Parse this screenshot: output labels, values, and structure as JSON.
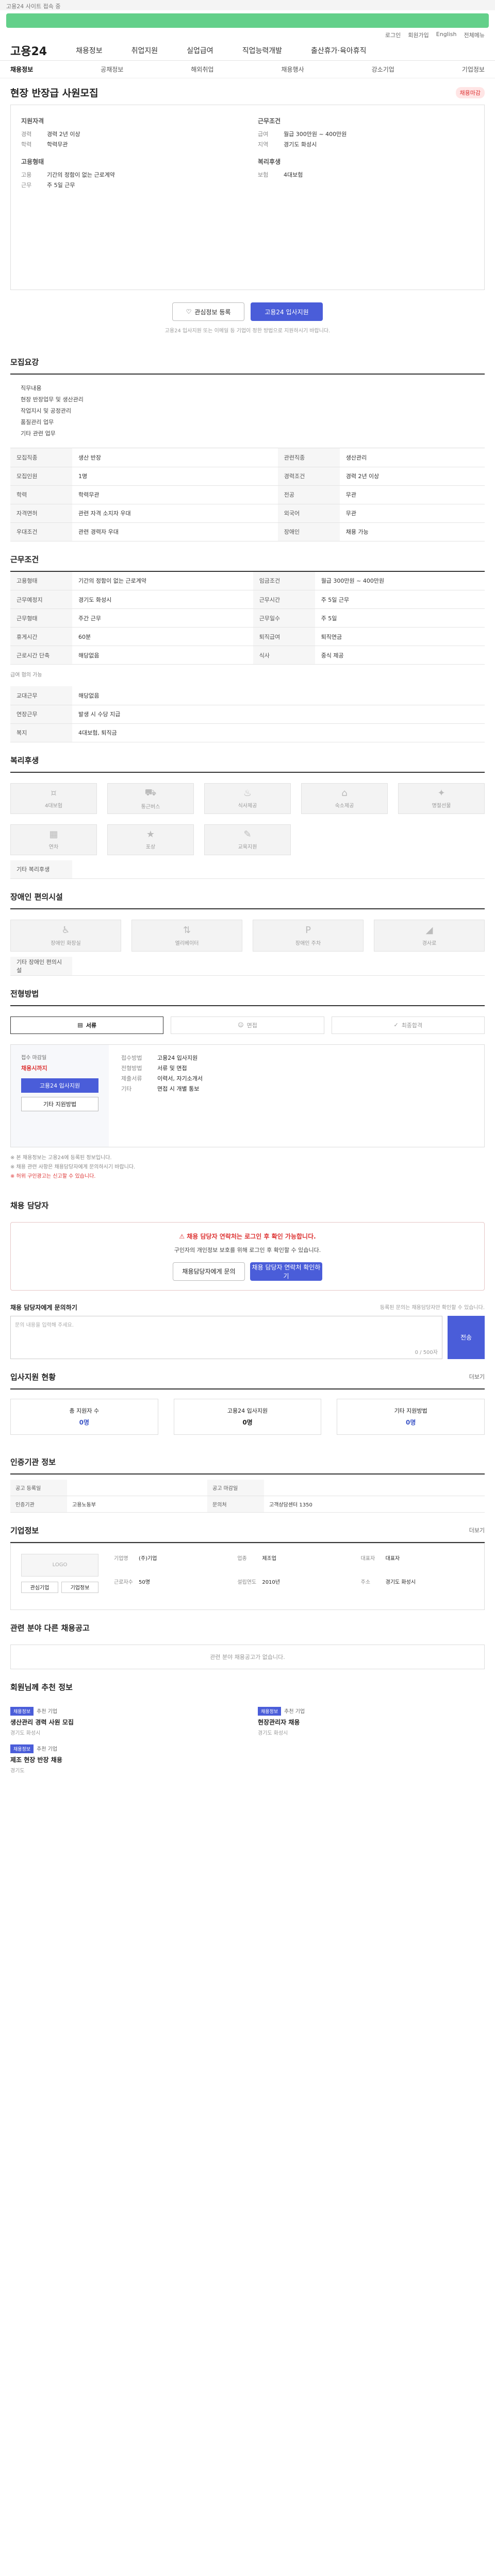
{
  "top_notice": "고용24 사이트 접속 중",
  "utility": [
    "로그인",
    "회원가입",
    "English",
    "전체메뉴"
  ],
  "gnb": {
    "logo": "고용24",
    "items": [
      "채용정보",
      "취업지원",
      "실업급여",
      "직업능력개발",
      "출산휴가·육아휴직"
    ]
  },
  "subnav": [
    "채용정보",
    "공채정보",
    "해외취업",
    "채용행사",
    "강소기업",
    "기업정보"
  ],
  "job": {
    "title": "현장 반장급 사원모집",
    "badge": "채용마감",
    "summary": {
      "h_qual": "지원자격",
      "qual": [
        [
          "경력",
          "경력 2년 이상"
        ],
        [
          "학력",
          "학력무관"
        ]
      ],
      "h_cond": "근무조건",
      "cond": [
        [
          "급여",
          "월급 300만원 ~ 400만원"
        ],
        [
          "지역",
          "경기도 화성시"
        ]
      ],
      "h_type": "고용형태",
      "type": [
        [
          "고용",
          "기간의 정함이 없는 근로계약"
        ],
        [
          "근무",
          "주 5일 근무"
        ]
      ],
      "h_benefit": "복리후생",
      "benefit": [
        [
          "보험",
          "4대보험"
        ]
      ]
    },
    "btn_interest": "관심정보 등록",
    "btn_apply": "고용24 입사지원",
    "caution": "고용24 입사지원 또는 이메일 등 기업이 정한 방법으로 지원하시기 바랍니다."
  },
  "duty": {
    "title": "모집요강",
    "desc": [
      "직무내용",
      "현장 반장업무 및 생산관리",
      "작업지시 및 공정관리",
      "품질관리 업무",
      "기타 관련 업무"
    ],
    "rows": [
      [
        "모집직종",
        "생산 반장",
        "관련직종",
        "생산관리"
      ],
      [
        "모집인원",
        "1명",
        "경력조건",
        "경력 2년 이상"
      ],
      [
        "학력",
        "학력무관",
        "전공",
        "무관"
      ],
      [
        "자격면허",
        "관련 자격 소지자 우대",
        "외국어",
        "무관"
      ],
      [
        "우대조건",
        "관련 경력자 우대",
        "장애인",
        "채용 가능"
      ]
    ]
  },
  "work": {
    "title": "근무조건",
    "rows": [
      [
        "고용형태",
        "기간의 정함이 없는 근로계약",
        "임금조건",
        "월급 300만원 ~ 400만원"
      ],
      [
        "근무예정지",
        "경기도 화성시",
        "근무시간",
        "주 5일 근무"
      ],
      [
        "근무형태",
        "주간 근무",
        "근무일수",
        "주 5일"
      ],
      [
        "휴게시간",
        "60분",
        "퇴직급여",
        "퇴직연금"
      ],
      [
        "근로시간 단축",
        "해당없음",
        "식사",
        "중식 제공"
      ]
    ],
    "wage_note": "급여 협의 가능",
    "rows2": [
      [
        "교대근무",
        "해당없음"
      ],
      [
        "연장근무",
        "발생 시 수당 지급"
      ],
      [
        "복지",
        "4대보험, 퇴직금"
      ]
    ]
  },
  "welfare": {
    "title": "복리후생",
    "icons": [
      [
        "money-icon",
        "4대보험",
        "¤"
      ],
      [
        "car-icon",
        "통근버스",
        "⛟"
      ],
      [
        "meal-icon",
        "식사제공",
        "♨"
      ],
      [
        "house-icon",
        "숙소제공",
        "⌂"
      ],
      [
        "gift-icon",
        "명절선물",
        "✦"
      ],
      [
        "calendar-icon",
        "연차",
        "▦"
      ],
      [
        "medal-icon",
        "포상",
        "★"
      ],
      [
        "book-icon",
        "교육지원",
        "✎"
      ]
    ],
    "extra_label": "기타 복리후생",
    "extra_value": ""
  },
  "disability": {
    "title": "장애인 편의시설",
    "icons": [
      [
        "wheelchair-icon",
        "장애인 화장실",
        "♿"
      ],
      [
        "elevator-icon",
        "엘리베이터",
        "⇅"
      ],
      [
        "parking-icon",
        "장애인 주차",
        "P"
      ],
      [
        "ramp-icon",
        "경사로",
        "◢"
      ]
    ],
    "extra_label": "기타 장애인 편의시설",
    "extra_value": ""
  },
  "selection": {
    "title": "전형방법",
    "tabs": [
      "서류",
      "면접",
      "최종합격"
    ],
    "steps_label": "전형절차",
    "deadline_label": "접수 마감일",
    "deadline": "채용시까지",
    "btn_apply": "고용24 입사지원",
    "btn_other": "기타 지원방법",
    "rows": [
      [
        "접수방법",
        "고용24 입사지원"
      ],
      [
        "전형방법",
        "서류 및 면접"
      ],
      [
        "제출서류",
        "이력서, 자기소개서"
      ],
      [
        "기타",
        "면접 시 개별 통보"
      ]
    ]
  },
  "notes": [
    "※ 본 채용정보는 고용24에 등록된 정보입니다.",
    "※ 채용 관련 사항은 채용담당자에게 문의하시기 바랍니다.",
    "※ 허위 구인광고는 신고할 수 있습니다."
  ],
  "contact": {
    "title": "채용 담당자",
    "warn": "채용 담당자 연락처는 로그인 후 확인 가능합니다.",
    "text": "구인자의 개인정보 보호를 위해 로그인 후 확인할 수 있습니다.",
    "btn1": "채용담당자에게 문의",
    "btn2": "채용 담당자 연락처 확인하기"
  },
  "qa": {
    "title": "채용 담당자에게 문의하기",
    "hint": "등록된 문의는 채용담당자만 확인할 수 있습니다.",
    "placeholder": "문의 내용을 입력해 주세요.",
    "count": "0 / 500자",
    "send": "전송"
  },
  "applicants": {
    "title": "입사지원 현황",
    "more": "더보기",
    "stats": [
      [
        "총 지원자 수",
        "0명"
      ],
      [
        "고용24 입사지원",
        "0명"
      ],
      [
        "기타 지원방법",
        "0명"
      ]
    ]
  },
  "posting": {
    "title": "인증기관 정보",
    "rows": [
      [
        "공고 등록일",
        "",
        "공고 마감일",
        ""
      ],
      [
        "인증기관",
        "고용노동부",
        "문의처",
        "고객상담센터 1350"
      ]
    ]
  },
  "company": {
    "title": "기업정보",
    "more": "더보기",
    "logo_ph": "LOGO",
    "btns": [
      "관심기업",
      "기업정보"
    ],
    "info": [
      [
        "기업명",
        "(주)기업"
      ],
      [
        "업종",
        "제조업"
      ],
      [
        "대표자",
        "대표자"
      ],
      [
        "근로자수",
        "50명"
      ],
      [
        "설립연도",
        "2010년"
      ],
      [
        "주소",
        "경기도 화성시"
      ]
    ]
  },
  "similar": {
    "title": "관련 분야 다른 채용공고",
    "empty": "관련 분야 채용공고가 없습니다."
  },
  "recommend": {
    "title": "회원님께 추천 정보",
    "items": [
      {
        "badge": "채용정보",
        "co": "추천 기업",
        "title": "생산관리 경력 사원 모집",
        "meta": "경기도 화성시"
      },
      {
        "badge": "채용정보",
        "co": "추천 기업",
        "title": "현장관리자 채용",
        "meta": "경기도 화성시"
      },
      {
        "badge": "채용정보",
        "co": "추천 기업",
        "title": "제조 현장 반장 채용",
        "meta": "경기도"
      }
    ]
  }
}
